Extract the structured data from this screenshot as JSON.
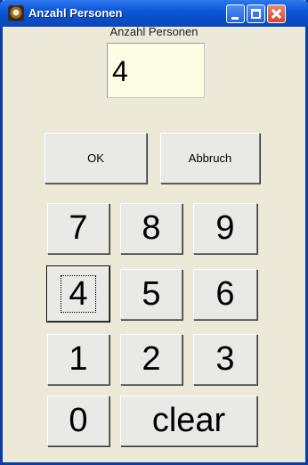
{
  "window": {
    "title": "Anzahl Personen"
  },
  "field": {
    "label": "Anzahl Personen",
    "value": "4"
  },
  "actions": {
    "ok": "OK",
    "cancel": "Abbruch"
  },
  "keypad": {
    "row1": [
      "7",
      "8",
      "9"
    ],
    "row2": [
      "4",
      "5",
      "6"
    ],
    "row3": [
      "1",
      "2",
      "3"
    ],
    "zero": "0",
    "clear": "clear"
  }
}
